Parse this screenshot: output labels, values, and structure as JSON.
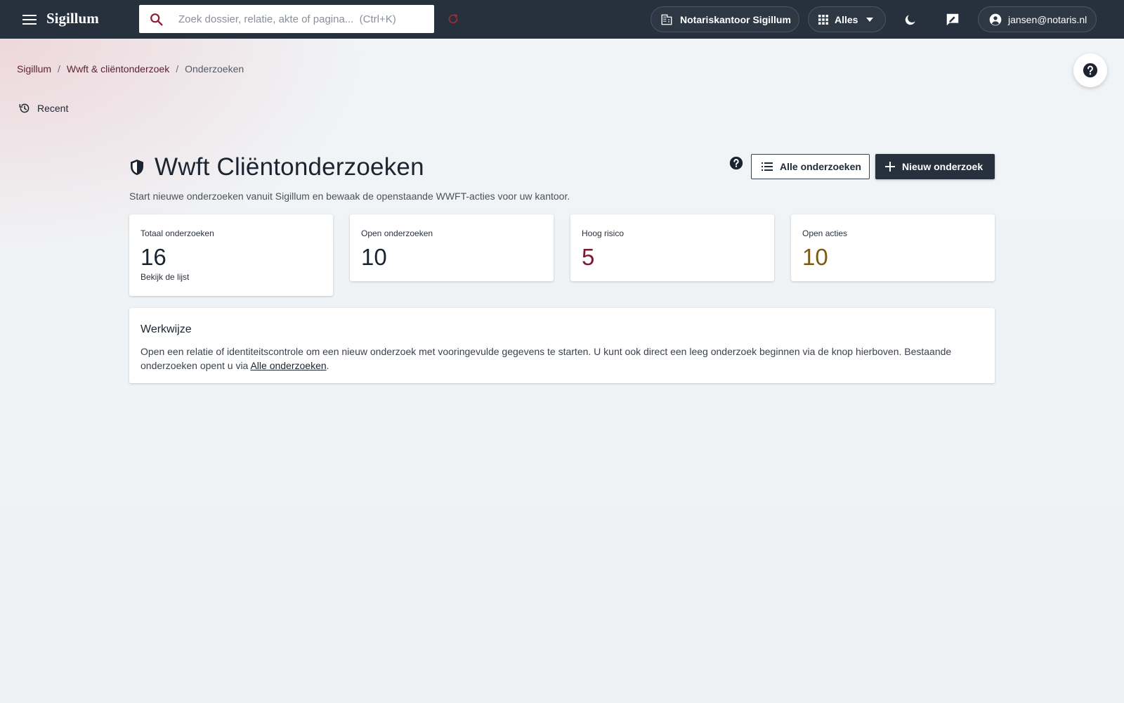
{
  "app": {
    "brand": "Sigillum"
  },
  "search": {
    "placeholder": "Zoek dossier, relatie, akte of pagina...  (Ctrl+K)"
  },
  "topbar": {
    "office_label": "Notariskantoor Sigillum",
    "scope_label": "Alles",
    "user_label": "jansen@notaris.nl"
  },
  "breadcrumb": {
    "items": [
      "Sigillum",
      "Wwft & cliëntonderzoek",
      "Onderzoeken"
    ],
    "separator": "/"
  },
  "recent": {
    "label": "Recent"
  },
  "page": {
    "title": "Wwft Cliëntonderzoeken",
    "subtitle": "Start nieuwe onderzoeken vanuit Sigillum en bewaak de openstaande WWFT-acties voor uw kantoor.",
    "all_button": "Alle onderzoeken",
    "new_button": "Nieuw onderzoek"
  },
  "stats": [
    {
      "label": "Totaal onderzoeken",
      "value": "16",
      "link": "Bekijk de lijst"
    },
    {
      "label": "Open onderzoeken",
      "value": "10"
    },
    {
      "label": "Hoog risico",
      "value": "5"
    },
    {
      "label": "Open acties",
      "value": "10"
    }
  ],
  "werkwijze": {
    "title": "Werkwijze",
    "text_before": "Open een relatie of identiteitscontrole om een nieuw onderzoek met vooringevulde gegevens te starten. U kunt ook direct een leeg onderzoek beginnen via de knop hierboven. Bestaande onderzoeken opent u via ",
    "link": "Alle onderzoeken",
    "text_after": "."
  },
  "colors": {
    "topbar": "#27313d",
    "accent": "#5b1f33",
    "risk": "#7a1a35",
    "action": "#7a5a14"
  },
  "icons": {
    "menu": "menu-icon",
    "search": "search-icon",
    "refresh": "refresh-icon",
    "office": "building-icon",
    "scope": "grid-icon",
    "theme": "moon-icon",
    "feedback": "feedback-icon",
    "user": "account-icon",
    "help": "help-icon",
    "recent": "history-icon",
    "page": "shield-icon",
    "list": "list-icon",
    "add": "plus-icon"
  }
}
